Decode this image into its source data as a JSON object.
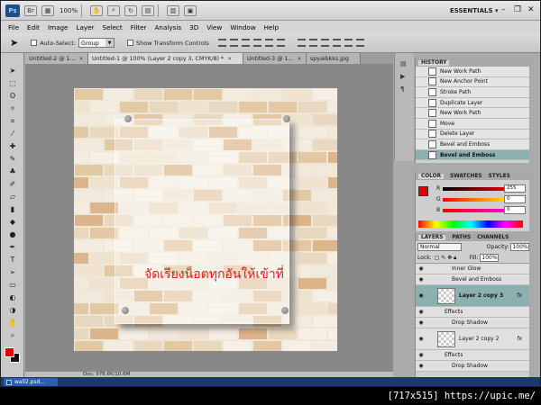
{
  "appbar": {
    "logo": "Ps",
    "zoom": "100%",
    "workspace": "ESSENTIALS",
    "workspace_arrow": "▾",
    "minimize": "–",
    "restore": "❐",
    "close": "✕"
  },
  "menu": [
    "File",
    "Edit",
    "Image",
    "Layer",
    "Select",
    "Filter",
    "Analysis",
    "3D",
    "View",
    "Window",
    "Help"
  ],
  "options": {
    "auto_select_label": "Auto-Select:",
    "auto_select_value": "Group",
    "show_transform_label": "Show Transform Controls"
  },
  "tabs": [
    {
      "label": "Untitled-2 @ 1...",
      "close": "×"
    },
    {
      "label": "Untitled-1 @ 100% (Layer 2 copy 3, CMYK/8) *",
      "close": "×"
    },
    {
      "label": "Untitled-3 @ 1...",
      "close": "×"
    },
    {
      "label": "spyaibkks.jpg",
      "close": ""
    }
  ],
  "canvas_text": "จัดเรียงน็อตทุกอันให้เข้าที่",
  "status": {
    "doc": "Doc: 976.6K/10.6M"
  },
  "taskbar": {
    "item": "wall2.psd..."
  },
  "history": {
    "title": "HISTORY",
    "items": [
      "New Work Path",
      "New Anchor Point",
      "Stroke Path",
      "Duplicate Layer",
      "New Work Path",
      "Move",
      "Delete Layer",
      "Bevel and Emboss",
      "Bevel and Emboss"
    ],
    "selected_index": 8
  },
  "color_panel": {
    "tabs": [
      "COLOR",
      "SWATCHES",
      "STYLES"
    ],
    "r_label": "R",
    "g_label": "G",
    "b_label": "B",
    "r_value": "255",
    "g_value": "0",
    "b_value": "0",
    "fg_color": "#e00000"
  },
  "layers": {
    "tabs": [
      "LAYERS",
      "PATHS",
      "CHANNELS"
    ],
    "blend_mode": "Normal",
    "opacity_label": "Opacity:",
    "opacity": "100%",
    "lock_label": "Lock:",
    "fill_label": "Fill:",
    "fill": "100%",
    "rows": [
      {
        "name": "Inner Glow",
        "kind": "effect"
      },
      {
        "name": "Bevel and Emboss",
        "kind": "effect"
      },
      {
        "name": "Layer 2 copy 3",
        "kind": "layer",
        "selected": true,
        "fx": "fx"
      },
      {
        "name": "Effects",
        "kind": "group"
      },
      {
        "name": "Drop Shadow",
        "kind": "effect"
      },
      {
        "name": "Layer 2 copy 2",
        "kind": "layer",
        "fx": "fx"
      },
      {
        "name": "Effects",
        "kind": "group"
      },
      {
        "name": "Drop Shadow",
        "kind": "effect"
      }
    ]
  },
  "credit": "[717x515] https://upic.me/"
}
